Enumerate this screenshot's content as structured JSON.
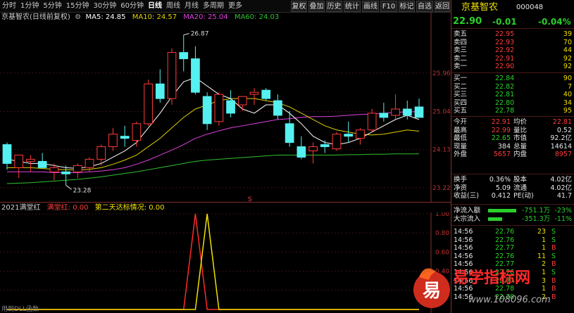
{
  "toolbar": {
    "periods": [
      "分时",
      "1分钟",
      "5分钟",
      "15分钟",
      "30分钟",
      "60分钟",
      "日线",
      "周线",
      "月线",
      "多周期",
      "更多"
    ],
    "active": "日线",
    "buttons": [
      "复权",
      "叠加",
      "历史",
      "统计",
      "画线",
      "F10",
      "标记",
      "自选",
      "返回"
    ]
  },
  "main_legend": {
    "title": "京基智农(日线前复权)",
    "ma5": "MA5: 24.85",
    "ma10": "MA10: 24.57",
    "ma20": "MA20: 25.04",
    "ma60": "MA60: 24.03"
  },
  "price_axis": [
    "25.96",
    "25.04",
    "24.13",
    "23.22"
  ],
  "annotations": {
    "high": "26.87",
    "low": "23.28",
    "marker": "S"
  },
  "sub_legend": {
    "name": "2021满堂红",
    "label_a": "满堂红: 0.00",
    "label_b": "第二天达标情况: 0.00"
  },
  "sub_axis": [
    "1.00",
    "0.80",
    "0.60",
    "0.40",
    "0.20"
  ],
  "footer_text": "用到DLL函数",
  "colors": {
    "up": "#ff3b3b",
    "down": "#55f0f0",
    "ma5": "#ffffff",
    "ma10": "#e0d000",
    "ma20": "#e040e0",
    "ma60": "#30c030"
  },
  "chart_data": {
    "type": "candlestick",
    "ylim": [
      23.0,
      27.2
    ],
    "candles": [
      {
        "o": 24.25,
        "h": 24.3,
        "l": 23.65,
        "c": 23.8
      },
      {
        "o": 23.7,
        "h": 24.0,
        "l": 23.45,
        "c": 24.0
      },
      {
        "o": 23.85,
        "h": 24.0,
        "l": 23.6,
        "c": 23.9
      },
      {
        "o": 23.85,
        "h": 24.05,
        "l": 23.75,
        "c": 23.7
      },
      {
        "o": 23.6,
        "h": 23.8,
        "l": 23.4,
        "c": 23.7
      },
      {
        "o": 23.6,
        "h": 23.75,
        "l": 23.28,
        "c": 23.55
      },
      {
        "o": 23.6,
        "h": 23.8,
        "l": 23.45,
        "c": 23.75
      },
      {
        "o": 23.7,
        "h": 23.95,
        "l": 23.6,
        "c": 23.9
      },
      {
        "o": 23.9,
        "h": 24.25,
        "l": 23.75,
        "c": 24.2
      },
      {
        "o": 24.2,
        "h": 24.65,
        "l": 24.1,
        "c": 24.5
      },
      {
        "o": 24.45,
        "h": 24.7,
        "l": 24.2,
        "c": 24.4
      },
      {
        "o": 24.35,
        "h": 24.8,
        "l": 24.2,
        "c": 24.75
      },
      {
        "o": 24.75,
        "h": 25.8,
        "l": 24.7,
        "c": 25.7
      },
      {
        "o": 25.7,
        "h": 26.05,
        "l": 25.25,
        "c": 25.35
      },
      {
        "o": 25.35,
        "h": 26.55,
        "l": 25.2,
        "c": 26.45
      },
      {
        "o": 26.45,
        "h": 26.87,
        "l": 26.0,
        "c": 26.3
      },
      {
        "o": 26.3,
        "h": 26.6,
        "l": 25.45,
        "c": 25.5
      },
      {
        "o": 25.4,
        "h": 25.5,
        "l": 24.6,
        "c": 24.75
      },
      {
        "o": 24.8,
        "h": 25.5,
        "l": 24.7,
        "c": 25.45
      },
      {
        "o": 25.3,
        "h": 25.55,
        "l": 24.9,
        "c": 25.0
      },
      {
        "o": 25.2,
        "h": 25.4,
        "l": 25.05,
        "c": 25.4
      },
      {
        "o": 25.45,
        "h": 25.6,
        "l": 25.2,
        "c": 25.5
      },
      {
        "o": 25.55,
        "h": 25.6,
        "l": 25.3,
        "c": 25.35
      },
      {
        "o": 25.3,
        "h": 25.45,
        "l": 24.85,
        "c": 24.95
      },
      {
        "o": 24.75,
        "h": 25.05,
        "l": 24.2,
        "c": 24.3
      },
      {
        "o": 24.2,
        "h": 24.45,
        "l": 23.9,
        "c": 23.95
      },
      {
        "o": 24.1,
        "h": 24.3,
        "l": 23.8,
        "c": 24.2
      },
      {
        "o": 24.25,
        "h": 24.35,
        "l": 24.05,
        "c": 24.2
      },
      {
        "o": 24.15,
        "h": 24.55,
        "l": 24.1,
        "c": 24.5
      },
      {
        "o": 24.5,
        "h": 24.8,
        "l": 24.3,
        "c": 24.45
      },
      {
        "o": 24.4,
        "h": 24.65,
        "l": 24.25,
        "c": 24.6
      },
      {
        "o": 24.6,
        "h": 25.1,
        "l": 24.55,
        "c": 25.0
      },
      {
        "o": 25.0,
        "h": 25.25,
        "l": 24.8,
        "c": 24.9
      },
      {
        "o": 24.95,
        "h": 25.45,
        "l": 24.85,
        "c": 25.1
      },
      {
        "o": 25.1,
        "h": 25.3,
        "l": 24.85,
        "c": 24.95
      },
      {
        "o": 25.15,
        "h": 25.35,
        "l": 24.95,
        "c": 24.9
      }
    ],
    "ma5": [
      23.9,
      23.85,
      23.8,
      23.8,
      23.75,
      23.7,
      23.68,
      23.72,
      23.8,
      23.95,
      24.1,
      24.3,
      24.65,
      25.0,
      25.4,
      25.75,
      25.85,
      25.65,
      25.45,
      25.35,
      25.1,
      25.0,
      25.2,
      25.2,
      25.0,
      24.75,
      24.45,
      24.3,
      24.25,
      24.3,
      24.4,
      24.55,
      24.7,
      24.85,
      24.95,
      24.85
    ],
    "ma10": [
      23.7,
      23.7,
      23.7,
      23.68,
      23.66,
      23.65,
      23.64,
      23.66,
      23.7,
      23.78,
      23.88,
      24.0,
      24.2,
      24.4,
      24.65,
      24.9,
      25.1,
      25.2,
      25.3,
      25.35,
      25.35,
      25.35,
      25.3,
      25.25,
      25.15,
      25.0,
      24.85,
      24.7,
      24.6,
      24.55,
      24.5,
      24.48,
      24.5,
      24.55,
      24.6,
      24.57
    ],
    "ma20": [
      23.6,
      23.6,
      23.6,
      23.6,
      23.58,
      23.58,
      23.58,
      23.6,
      23.62,
      23.65,
      23.7,
      23.78,
      23.88,
      24.0,
      24.12,
      24.25,
      24.4,
      24.5,
      24.58,
      24.65,
      24.7,
      24.75,
      24.8,
      24.85,
      24.87,
      24.9,
      24.92,
      24.92,
      24.93,
      24.95,
      24.97,
      24.98,
      25.0,
      25.02,
      25.03,
      25.04
    ],
    "ma60": [
      23.32,
      23.33,
      23.34,
      23.36,
      23.38,
      23.4,
      23.42,
      23.45,
      23.48,
      23.52,
      23.56,
      23.6,
      23.65,
      23.7,
      23.75,
      23.8,
      23.85,
      23.88,
      23.9,
      23.92,
      23.94,
      23.96,
      23.98,
      24.0,
      24.0,
      24.0,
      24.0,
      24.0,
      24.0,
      24.01,
      24.01,
      24.02,
      24.02,
      24.03,
      24.03,
      24.03
    ],
    "signal_red": [
      0,
      0,
      0,
      0,
      0,
      0,
      0,
      0,
      0,
      0,
      0,
      0,
      0,
      0,
      0,
      0,
      0,
      0,
      0,
      0,
      0,
      0,
      0,
      0,
      0,
      0,
      0,
      0,
      0,
      0,
      0,
      0,
      0,
      0,
      0,
      0
    ],
    "signal_yellow": [
      0,
      0,
      0,
      0,
      0,
      0,
      0,
      0,
      0,
      0,
      0,
      0,
      0,
      0,
      0,
      0,
      0,
      0,
      0,
      0,
      0,
      0,
      0,
      0,
      0,
      0,
      0,
      0,
      0,
      0,
      0,
      0,
      0,
      0,
      0,
      0
    ]
  },
  "signals": {
    "red_peak_index": 16,
    "yellow_peak_index": 17
  },
  "panel": {
    "name": "京基智农",
    "code": "000048",
    "price": "22.90",
    "change": "-0.01",
    "pct": "-0.04%",
    "asks": [
      {
        "label": "卖五",
        "price": "22.95",
        "vol": "39"
      },
      {
        "label": "卖四",
        "price": "22.93",
        "vol": "70"
      },
      {
        "label": "卖三",
        "price": "22.92",
        "vol": "44"
      },
      {
        "label": "卖二",
        "price": "22.91",
        "vol": "92"
      },
      {
        "label": "卖一",
        "price": "22.90",
        "vol": "92"
      }
    ],
    "bids": [
      {
        "label": "买一",
        "price": "22.84",
        "vol": "90"
      },
      {
        "label": "买二",
        "price": "22.82",
        "vol": "7"
      },
      {
        "label": "买三",
        "price": "22.81",
        "vol": "40"
      },
      {
        "label": "买四",
        "price": "22.80",
        "vol": "34"
      },
      {
        "label": "买五",
        "price": "22.78",
        "vol": "95"
      }
    ],
    "stats": [
      {
        "l1": "今开",
        "v1": "22.91",
        "l2": "均价",
        "v2": "22.81"
      },
      {
        "l1": "最高",
        "v1": "22.99",
        "l2": "量比",
        "v2": "0.52"
      },
      {
        "l1": "最低",
        "v1": "22.65",
        "l2": "市值",
        "v2": "92.2亿"
      },
      {
        "l1": "现量",
        "v1": "384",
        "l2": "总量",
        "v2": "14614"
      },
      {
        "l1": "外盘",
        "v1": "5657",
        "l2": "内盘",
        "v2": "8957"
      }
    ],
    "stats2": [
      {
        "l1": "换手",
        "v1": "0.36%",
        "l2": "股本",
        "v2": "4.02亿"
      },
      {
        "l1": "净资",
        "v1": "5.09",
        "l2": "流通",
        "v2": "4.02亿"
      },
      {
        "l1": "收益(三)",
        "v1": "0.412",
        "l2": "PE(动)",
        "v2": "41.7"
      }
    ],
    "flows": [
      {
        "label": "净流入额",
        "value": "-751.1万",
        "pct": "-23%"
      },
      {
        "label": "大宗流入",
        "value": "-351.3万",
        "pct": "-11%"
      }
    ],
    "ticks": [
      {
        "t": "14:56",
        "p": "22.76",
        "v": "23",
        "s": "S"
      },
      {
        "t": "14:56",
        "p": "22.76",
        "v": "1",
        "s": "S"
      },
      {
        "t": "14:56",
        "p": "22.77",
        "v": "1",
        "s": "B"
      },
      {
        "t": "14:56",
        "p": "22.76",
        "v": "11",
        "s": "S"
      },
      {
        "t": "14:56",
        "p": "22.77",
        "v": "2",
        "s": "B"
      },
      {
        "t": "14:56",
        "p": "22.76",
        "v": "1",
        "s": "S"
      },
      {
        "t": "14:56",
        "p": "22.77",
        "v": "3",
        "s": "B"
      },
      {
        "t": "14:56",
        "p": "22.78",
        "v": "1",
        "s": "B"
      },
      {
        "t": "14:56",
        "p": "22.78",
        "v": "2",
        "s": "B"
      }
    ]
  },
  "watermark": {
    "brand": "易学指标网",
    "url": "www.108096.com",
    "logo_char": "易"
  }
}
